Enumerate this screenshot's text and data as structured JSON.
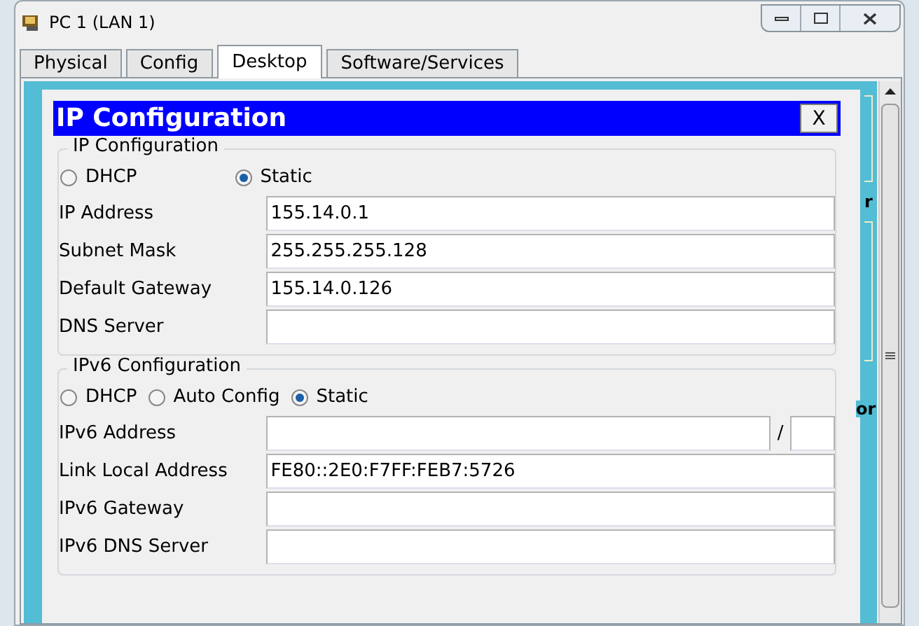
{
  "window": {
    "title": "PC 1 (LAN 1)"
  },
  "tabs": [
    {
      "label": "Physical",
      "selected": false
    },
    {
      "label": "Config",
      "selected": false
    },
    {
      "label": "Desktop",
      "selected": true
    },
    {
      "label": "Software/Services",
      "selected": false
    }
  ],
  "dialog": {
    "title": "IP Configuration",
    "close": "X",
    "ipv4": {
      "legend": "IP Configuration",
      "modes": [
        {
          "label": "DHCP",
          "selected": false
        },
        {
          "label": "Static",
          "selected": true
        }
      ],
      "fields": [
        {
          "label": "IP Address",
          "value": "155.14.0.1"
        },
        {
          "label": "Subnet Mask",
          "value": "255.255.255.128"
        },
        {
          "label": "Default Gateway",
          "value": "155.14.0.126"
        },
        {
          "label": "DNS Server"
        }
      ]
    },
    "ipv6": {
      "legend": "IPv6 Configuration",
      "modes": [
        {
          "label": "DHCP",
          "selected": false
        },
        {
          "label": "Auto Config",
          "selected": false
        },
        {
          "label": "Static",
          "selected": true
        }
      ],
      "fields": [
        {
          "label": "IPv6 Address",
          "kind": "prefix",
          "separator": "/"
        },
        {
          "label": "Link Local Address",
          "value": "FE80::2E0:F7FF:FEB7:5726"
        },
        {
          "label": "IPv6 Gateway"
        },
        {
          "label": "IPv6 DNS Server"
        }
      ]
    }
  },
  "background_fragments": [
    "r",
    "or"
  ]
}
